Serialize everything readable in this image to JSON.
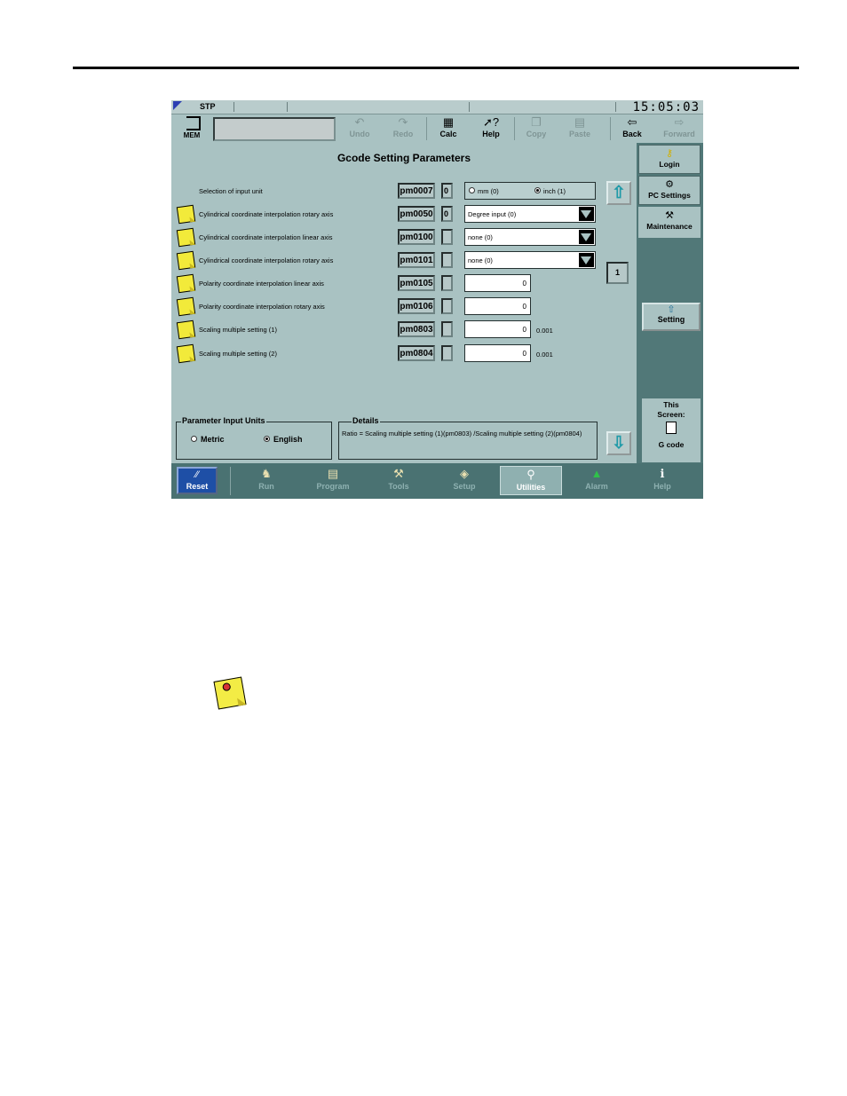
{
  "status": {
    "mode": "STP",
    "clock": "15:05:03"
  },
  "toolbar": {
    "mem_label": "MEM",
    "buttons": [
      {
        "label": "Undo",
        "icon": "undo-icon",
        "enabled": false
      },
      {
        "label": "Redo",
        "icon": "redo-icon",
        "enabled": false
      },
      {
        "label": "Calc",
        "icon": "calculator-icon",
        "enabled": true
      },
      {
        "label": "Help",
        "icon": "help-icon",
        "enabled": true
      },
      {
        "label": "Copy",
        "icon": "copy-icon",
        "enabled": false
      },
      {
        "label": "Paste",
        "icon": "paste-icon",
        "enabled": false
      },
      {
        "label": "Back",
        "icon": "back-arrow-icon",
        "enabled": true
      },
      {
        "label": "Forward",
        "icon": "forward-arrow-icon",
        "enabled": false
      }
    ]
  },
  "main": {
    "title": "Gcode Setting Parameters",
    "page_number": "1",
    "params": [
      {
        "desc": "Selection of input unit",
        "pm": "pm0007",
        "value": "0",
        "control": "radio",
        "options": [
          "mm (0)",
          "inch (1)"
        ],
        "selected": "inch (1)",
        "has_note": false
      },
      {
        "desc": "Cylindrical coordinate interpolation rotary axis",
        "pm": "pm0050",
        "value": "0",
        "control": "select",
        "selected": "Degree input (0)",
        "has_note": true
      },
      {
        "desc": "Cylindrical coordinate interpolation linear axis",
        "pm": "pm0100",
        "value": "",
        "control": "select",
        "selected": "none (0)",
        "has_note": true
      },
      {
        "desc": "Cylindrical coordinate interpolation rotary axis",
        "pm": "pm0101",
        "value": "",
        "control": "select",
        "selected": "none (0)",
        "has_note": true
      },
      {
        "desc": "Polarity coordinate interpolation linear axis",
        "pm": "pm0105",
        "value": "",
        "control": "number",
        "number": "0",
        "unit": "",
        "has_note": true
      },
      {
        "desc": "Polarity coordinate interpolation rotary axis",
        "pm": "pm0106",
        "value": "",
        "control": "number",
        "number": "0",
        "unit": "",
        "has_note": true
      },
      {
        "desc": "Scaling multiple setting (1)",
        "pm": "pm0803",
        "value": "",
        "control": "number",
        "number": "0",
        "unit": "0.001",
        "has_note": true
      },
      {
        "desc": "Scaling multiple setting (2)",
        "pm": "pm0804",
        "value": "",
        "control": "number",
        "number": "0",
        "unit": "0.001",
        "has_note": true
      }
    ],
    "input_units": {
      "title": "Parameter Input Units",
      "options": [
        "Metric",
        "English"
      ],
      "selected": "English"
    },
    "details": {
      "title": "Details",
      "text": "Ratio = Scaling multiple setting (1)(pm0803) /Scaling multiple setting (2)(pm0804)"
    }
  },
  "sidebar": {
    "tabs": [
      {
        "label": "Login",
        "icon": "key-icon"
      },
      {
        "label": "PC Settings",
        "icon": "pc-settings-icon"
      },
      {
        "label": "Maintenance",
        "icon": "maintenance-icon"
      }
    ],
    "setting_label": "Setting",
    "this_screen": {
      "line1": "This",
      "line2": "Screen:",
      "name": "G code"
    }
  },
  "bottom_nav": {
    "reset": "Reset",
    "items": [
      {
        "label": "Run",
        "icon": "run-icon"
      },
      {
        "label": "Program",
        "icon": "program-icon"
      },
      {
        "label": "Tools",
        "icon": "tools-icon"
      },
      {
        "label": "Setup",
        "icon": "setup-icon"
      },
      {
        "label": "Utilities",
        "icon": "utilities-icon",
        "active": true
      },
      {
        "label": "Alarm",
        "icon": "alarm-icon"
      },
      {
        "label": "Help",
        "icon": "info-icon"
      }
    ]
  },
  "colors": {
    "panel": "#a9c2c2",
    "sidebar": "#517878",
    "nav": "#4a7272",
    "reset": "#1e4fa6",
    "arrow": "#1f9aa8",
    "note": "#f2ea3a"
  }
}
